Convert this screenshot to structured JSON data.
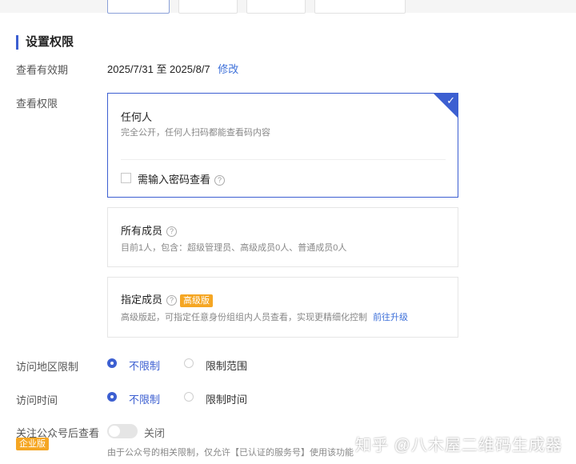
{
  "section": {
    "title": "设置权限"
  },
  "validity": {
    "label": "查看有效期",
    "range": "2025/7/31 至 2025/8/7",
    "edit_link": "修改"
  },
  "permissions": {
    "label": "查看权限",
    "options": [
      {
        "title": "任何人",
        "desc": "完全公开，任何人扫码都能查看码内容",
        "selected": true
      },
      {
        "title": "所有成员",
        "desc": "目前1人，包含：超级管理员、高级成员0人、普通成员0人",
        "selected": false
      },
      {
        "title": "指定成员",
        "badge": "高级版",
        "desc": "高级版起，可指定任意身份组组内人员查看，实现更精细化控制",
        "link": "前往升级",
        "selected": false
      }
    ],
    "password_checkbox": {
      "label": "需输入密码查看",
      "checked": false
    }
  },
  "region_limit": {
    "label": "访问地区限制",
    "options": [
      "不限制",
      "限制范围"
    ],
    "selected": "不限制"
  },
  "time_limit": {
    "label": "访问时间",
    "options": [
      "不限制",
      "限制时间"
    ],
    "selected": "不限制"
  },
  "follow_account": {
    "label": "关注公众号后查看",
    "badge": "企业版",
    "toggle_label": "关闭",
    "toggle_on": false,
    "note": "由于公众号的相关限制，仅允许【已认证的服务号】使用该功能"
  },
  "watermark": "知乎 @八木屋二维码生成器",
  "colors": {
    "accent": "#3c5fd1",
    "badge": "#f5a623",
    "link": "#3c6fd9"
  }
}
